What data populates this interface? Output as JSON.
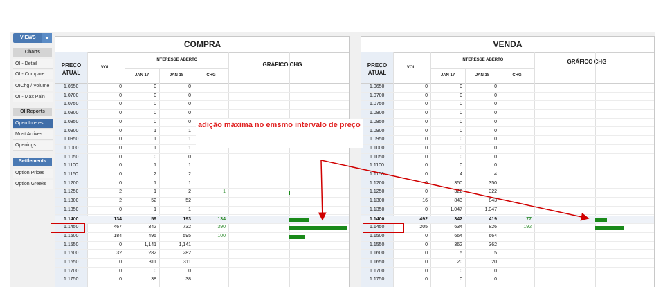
{
  "sidebar": {
    "views_label": "VIEWS",
    "charts_header": "Charts",
    "charts_items": [
      "OI - Detail",
      "OI - Compare",
      "OIChg / Volume",
      "OI - Max Pain"
    ],
    "oi_reports_header": "OI Reports",
    "oi_reports_items": [
      "Open Interest",
      "Most Actives",
      "Openings"
    ],
    "settlements_header": "Settlements",
    "settlements_items": [
      "Option Prices",
      "Option Greeks"
    ]
  },
  "compra": {
    "title": "COMPRA",
    "price_header": "PREÇO ATUAL",
    "vol_header": "VOL",
    "oi_header": "INTERESSE ABERTO",
    "jan17_header": "JAN 17",
    "jan18_header": "JAN 18",
    "chg_header": "CHG",
    "graph_header": "GRÁFICO CHG"
  },
  "venda": {
    "title": "VENDA",
    "price_header": "PREÇO ATUAL",
    "vol_header": "VOL",
    "oi_header": "INTERESSE ABERTO",
    "jan17_header": "JAN 17",
    "jan18_header": "JAN 18",
    "chg_header": "CHG",
    "graph_header": "GRÁFICO CHG"
  },
  "compra_rows": [
    {
      "price": "1.0650",
      "vol": "0",
      "jan17": "0",
      "jan18": "0",
      "chg": "",
      "bar": 0
    },
    {
      "price": "1.0700",
      "vol": "0",
      "jan17": "0",
      "jan18": "0",
      "chg": "",
      "bar": 0
    },
    {
      "price": "1.0750",
      "vol": "0",
      "jan17": "0",
      "jan18": "0",
      "chg": "",
      "bar": 0
    },
    {
      "price": "1.0800",
      "vol": "0",
      "jan17": "0",
      "jan18": "0",
      "chg": "",
      "bar": 0
    },
    {
      "price": "1.0850",
      "vol": "0",
      "jan17": "0",
      "jan18": "0",
      "chg": "",
      "bar": 0
    },
    {
      "price": "1.0900",
      "vol": "0",
      "jan17": "1",
      "jan18": "1",
      "chg": "",
      "bar": 0
    },
    {
      "price": "1.0950",
      "vol": "0",
      "jan17": "1",
      "jan18": "1",
      "chg": "",
      "bar": 0
    },
    {
      "price": "1.1000",
      "vol": "0",
      "jan17": "1",
      "jan18": "1",
      "chg": "",
      "bar": 0
    },
    {
      "price": "1.1050",
      "vol": "0",
      "jan17": "0",
      "jan18": "0",
      "chg": "",
      "bar": 0
    },
    {
      "price": "1.1100",
      "vol": "0",
      "jan17": "1",
      "jan18": "1",
      "chg": "",
      "bar": 0
    },
    {
      "price": "1.1150",
      "vol": "0",
      "jan17": "2",
      "jan18": "2",
      "chg": "",
      "bar": 0
    },
    {
      "price": "1.1200",
      "vol": "0",
      "jan17": "1",
      "jan18": "1",
      "chg": "",
      "bar": 0
    },
    {
      "price": "1.1250",
      "vol": "2",
      "jan17": "1",
      "jan18": "2",
      "chg": "1",
      "bar": 1
    },
    {
      "price": "1.1300",
      "vol": "2",
      "jan17": "52",
      "jan18": "52",
      "chg": "",
      "bar": 0
    },
    {
      "price": "1.1350",
      "vol": "0",
      "jan17": "1",
      "jan18": "1",
      "chg": "",
      "bar": 0
    },
    {
      "price": "1.1400",
      "vol": "134",
      "jan17": "59",
      "jan18": "193",
      "chg": "134",
      "bar": 134,
      "bold": true
    },
    {
      "price": "1.1450",
      "vol": "467",
      "jan17": "342",
      "jan18": "732",
      "chg": "390",
      "bar": 390
    },
    {
      "price": "1.1500",
      "vol": "184",
      "jan17": "495",
      "jan18": "595",
      "chg": "100",
      "bar": 100
    },
    {
      "price": "1.1550",
      "vol": "0",
      "jan17": "1,141",
      "jan18": "1,141",
      "chg": "",
      "bar": 0
    },
    {
      "price": "1.1600",
      "vol": "32",
      "jan17": "282",
      "jan18": "282",
      "chg": "",
      "bar": 0
    },
    {
      "price": "1.1650",
      "vol": "0",
      "jan17": "311",
      "jan18": "311",
      "chg": "",
      "bar": 0
    },
    {
      "price": "1.1700",
      "vol": "0",
      "jan17": "0",
      "jan18": "0",
      "chg": "",
      "bar": 0
    },
    {
      "price": "1.1750",
      "vol": "0",
      "jan17": "38",
      "jan18": "38",
      "chg": "",
      "bar": 0
    }
  ],
  "venda_rows": [
    {
      "price": "1.0650",
      "vol": "0",
      "jan17": "0",
      "jan18": "0",
      "chg": "",
      "bar": 0
    },
    {
      "price": "1.0700",
      "vol": "0",
      "jan17": "0",
      "jan18": "0",
      "chg": "",
      "bar": 0
    },
    {
      "price": "1.0750",
      "vol": "0",
      "jan17": "0",
      "jan18": "0",
      "chg": "",
      "bar": 0
    },
    {
      "price": "1.0800",
      "vol": "0",
      "jan17": "0",
      "jan18": "0",
      "chg": "",
      "bar": 0
    },
    {
      "price": "1.0850",
      "vol": "0",
      "jan17": "0",
      "jan18": "0",
      "chg": "",
      "bar": 0
    },
    {
      "price": "1.0900",
      "vol": "0",
      "jan17": "0",
      "jan18": "0",
      "chg": "",
      "bar": 0
    },
    {
      "price": "1.0950",
      "vol": "0",
      "jan17": "0",
      "jan18": "0",
      "chg": "",
      "bar": 0
    },
    {
      "price": "1.1000",
      "vol": "0",
      "jan17": "0",
      "jan18": "0",
      "chg": "",
      "bar": 0
    },
    {
      "price": "1.1050",
      "vol": "0",
      "jan17": "0",
      "jan18": "0",
      "chg": "",
      "bar": 0
    },
    {
      "price": "1.1100",
      "vol": "0",
      "jan17": "0",
      "jan18": "0",
      "chg": "",
      "bar": 0
    },
    {
      "price": "1.1150",
      "vol": "0",
      "jan17": "4",
      "jan18": "4",
      "chg": "",
      "bar": 0
    },
    {
      "price": "1.1200",
      "vol": "0",
      "jan17": "350",
      "jan18": "350",
      "chg": "",
      "bar": 0
    },
    {
      "price": "1.1250",
      "vol": "0",
      "jan17": "322",
      "jan18": "322",
      "chg": "",
      "bar": 0
    },
    {
      "price": "1.1300",
      "vol": "16",
      "jan17": "843",
      "jan18": "843",
      "chg": "",
      "bar": 0
    },
    {
      "price": "1.1350",
      "vol": "0",
      "jan17": "1,047",
      "jan18": "1,047",
      "chg": "",
      "bar": 0
    },
    {
      "price": "1.1400",
      "vol": "492",
      "jan17": "342",
      "jan18": "419",
      "chg": "77",
      "bar": 77,
      "bold": true
    },
    {
      "price": "1.1450",
      "vol": "205",
      "jan17": "634",
      "jan18": "826",
      "chg": "192",
      "bar": 192
    },
    {
      "price": "1.1500",
      "vol": "0",
      "jan17": "664",
      "jan18": "664",
      "chg": "",
      "bar": 0
    },
    {
      "price": "1.1550",
      "vol": "0",
      "jan17": "362",
      "jan18": "362",
      "chg": "",
      "bar": 0
    },
    {
      "price": "1.1600",
      "vol": "0",
      "jan17": "5",
      "jan18": "5",
      "chg": "",
      "bar": 0
    },
    {
      "price": "1.1650",
      "vol": "0",
      "jan17": "20",
      "jan18": "20",
      "chg": "",
      "bar": 0
    },
    {
      "price": "1.1700",
      "vol": "0",
      "jan17": "0",
      "jan18": "0",
      "chg": "",
      "bar": 0
    },
    {
      "price": "1.1750",
      "vol": "0",
      "jan17": "0",
      "jan18": "0",
      "chg": "",
      "bar": 0
    }
  ],
  "annotation": {
    "text": "adição máxima no emsmo intervalo de preço",
    "color": "#e02020"
  },
  "colors": {
    "accent": "#4a79b3",
    "bar": "#1a8a1a",
    "chg_text": "#2e8b2e",
    "highlight": "#d00000"
  }
}
